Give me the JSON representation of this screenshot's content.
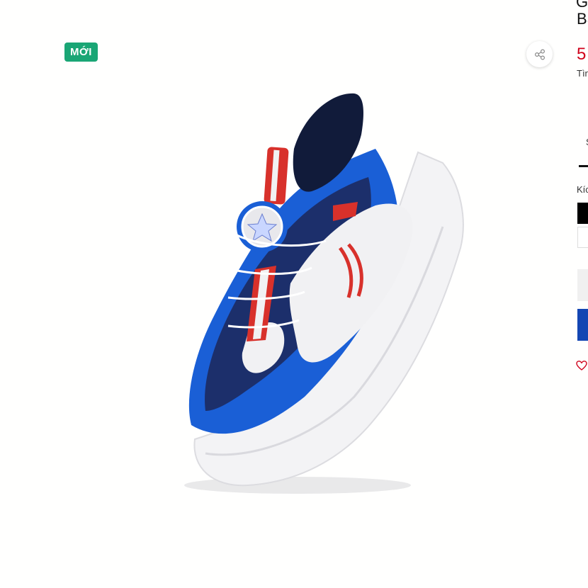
{
  "badge": {
    "label": "MỚI"
  },
  "share": {
    "icon": "share-icon"
  },
  "product": {
    "image_alt": "blue-white-red kids sneaker with twist-lock dial",
    "colors": {
      "blue": "#1a5fd6",
      "navy": "#1c2f6b",
      "white": "#f1f1f3",
      "red": "#d8312b",
      "sole": "#f4f4f6"
    }
  },
  "info": {
    "name_line1": "G",
    "name_line2": "BS",
    "price": "5",
    "price_color": "#d0021b",
    "subtext": "Tìn",
    "tab_label": "S",
    "size_label": "Kíc",
    "wishlist_icon": "heart-outline-icon"
  }
}
